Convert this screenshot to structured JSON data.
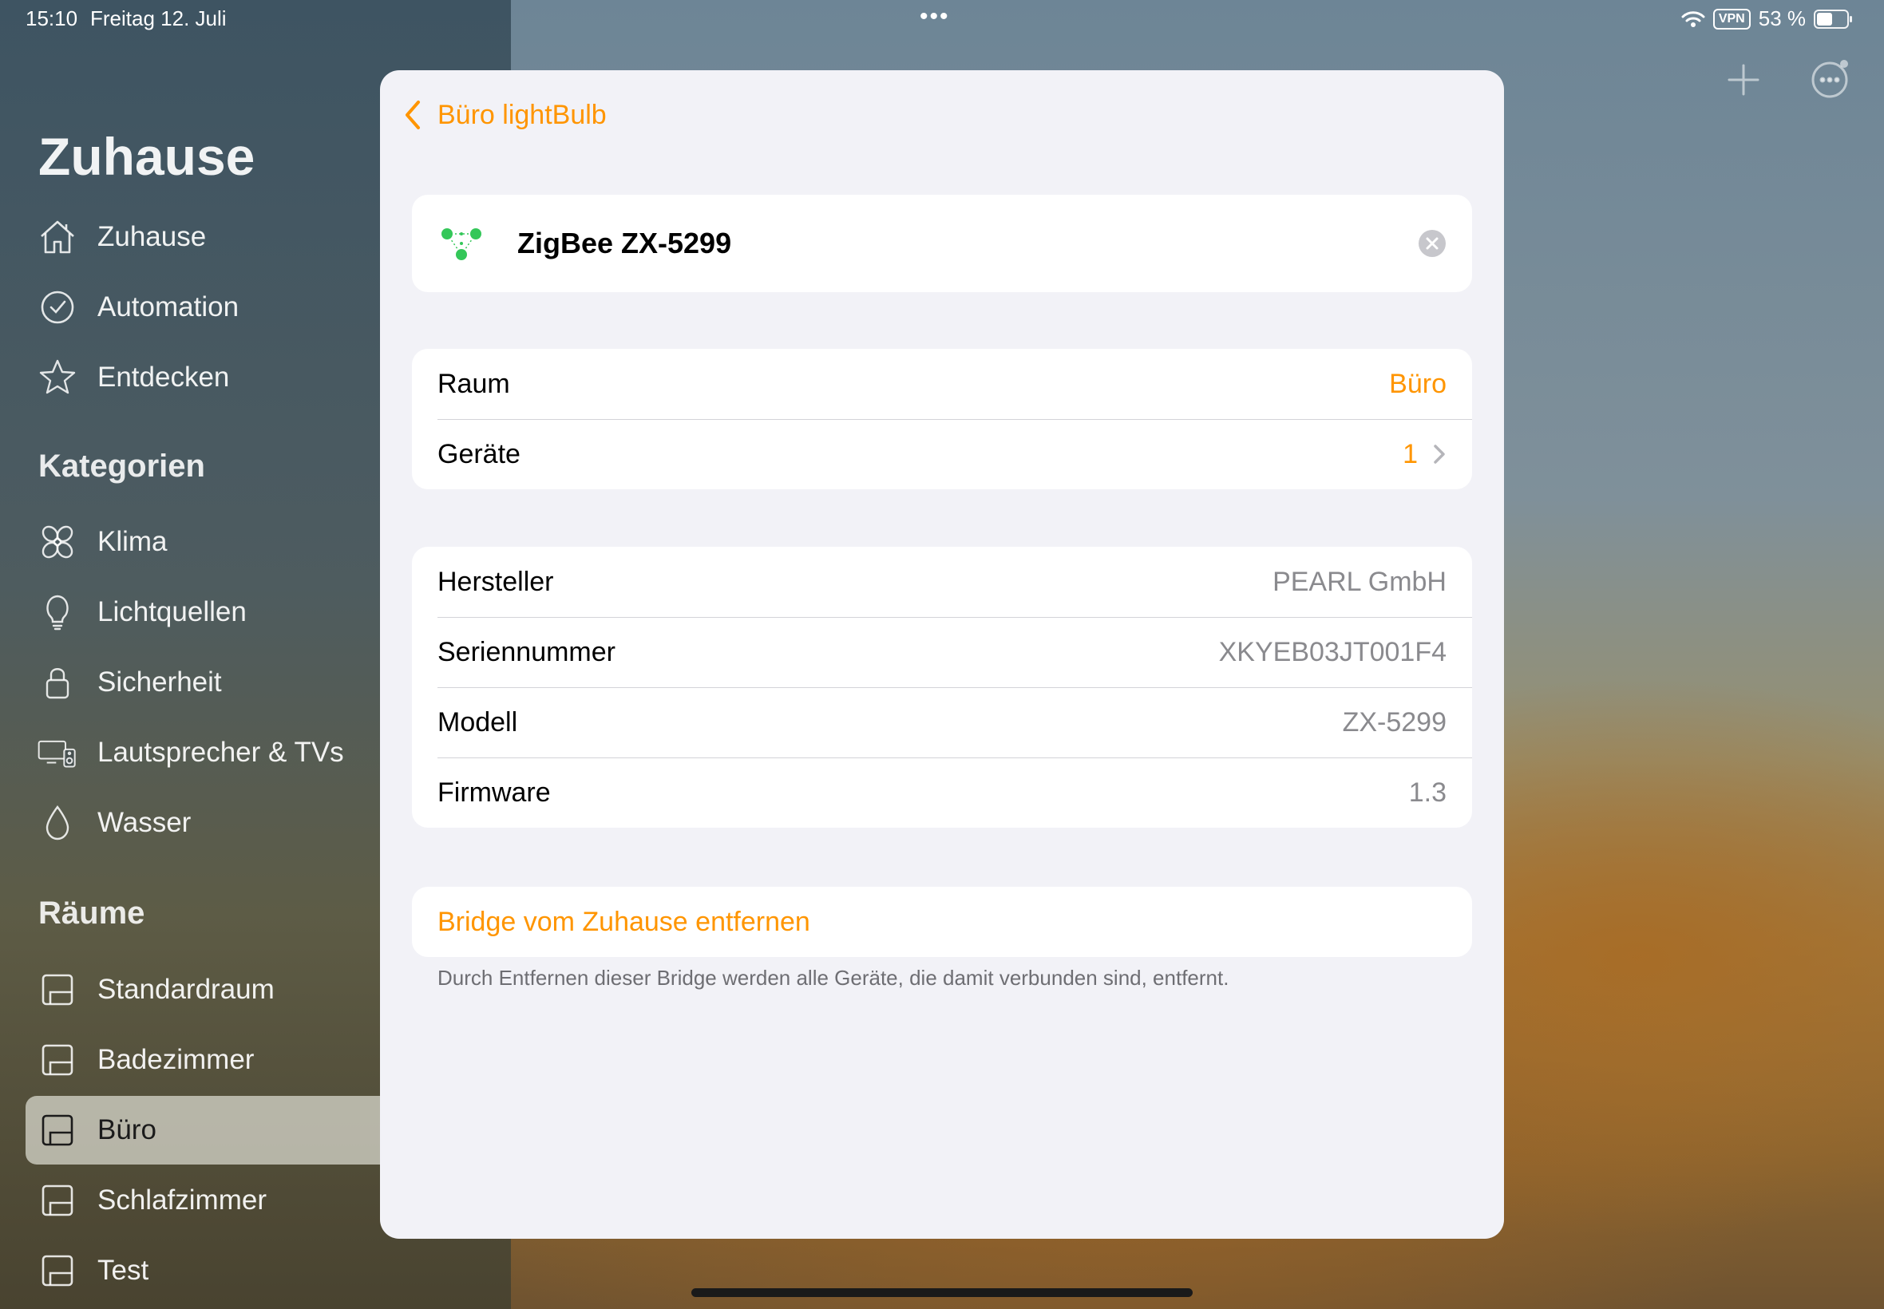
{
  "status_bar": {
    "time": "15:10",
    "date": "Freitag 12. Juli",
    "vpn_label": "VPN",
    "battery_text": "53 %",
    "battery_level": 0.53
  },
  "sidebar": {
    "title": "Zuhause",
    "nav": [
      {
        "label": "Zuhause",
        "icon": "house-icon"
      },
      {
        "label": "Automation",
        "icon": "clock-icon"
      },
      {
        "label": "Entdecken",
        "icon": "star-icon"
      }
    ],
    "categories_header": "Kategorien",
    "categories": [
      {
        "label": "Klima",
        "icon": "fan-icon"
      },
      {
        "label": "Lichtquellen",
        "icon": "lightbulb-icon"
      },
      {
        "label": "Sicherheit",
        "icon": "lock-icon"
      },
      {
        "label": "Lautsprecher & TVs",
        "icon": "speaker-tv-icon"
      },
      {
        "label": "Wasser",
        "icon": "water-drop-icon"
      }
    ],
    "rooms_header": "Räume",
    "rooms": [
      {
        "label": "Standardraum",
        "icon": "room-icon"
      },
      {
        "label": "Badezimmer",
        "icon": "room-icon"
      },
      {
        "label": "Büro",
        "icon": "room-icon",
        "selected": true
      },
      {
        "label": "Schlafzimmer",
        "icon": "room-icon"
      },
      {
        "label": "Test",
        "icon": "room-icon"
      }
    ]
  },
  "modal": {
    "back_label": "Büro lightBulb",
    "device_name": "ZigBee ZX-5299",
    "location": {
      "room_label": "Raum",
      "room_value": "Büro",
      "devices_label": "Geräte",
      "devices_value": "1"
    },
    "info": [
      {
        "label": "Hersteller",
        "value": "PEARL GmbH"
      },
      {
        "label": "Seriennummer",
        "value": "XKYEB03JT001F4"
      },
      {
        "label": "Modell",
        "value": "ZX-5299"
      },
      {
        "label": "Firmware",
        "value": "1.3"
      }
    ],
    "remove_label": "Bridge vom Zuhause entfernen",
    "remove_note": "Durch Entfernen dieser Bridge werden alle Geräte, die damit verbunden sind, entfernt."
  },
  "colors": {
    "accent": "#ff9500",
    "device_icon": "#34c759",
    "modal_bg": "#f2f2f7"
  }
}
